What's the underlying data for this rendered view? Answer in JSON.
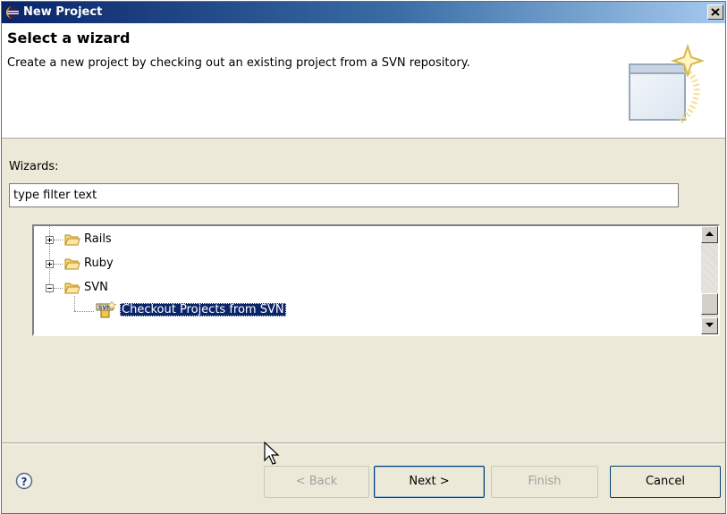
{
  "window": {
    "title": "New Project",
    "close_label": "Close"
  },
  "header": {
    "heading": "Select a wizard",
    "description": "Create a new project by checking out an existing project from a SVN repository."
  },
  "wizards_label": "Wizards:",
  "filter": {
    "value": "type filter text"
  },
  "tree": {
    "items": [
      {
        "label": "Rails",
        "expanded": false,
        "icon": "folder-icon"
      },
      {
        "label": "Ruby",
        "expanded": false,
        "icon": "folder-icon"
      },
      {
        "label": "SVN",
        "expanded": true,
        "icon": "folder-open-icon",
        "children": [
          {
            "label": "Checkout Projects from SVN",
            "icon": "svn-checkout-icon",
            "selected": true
          }
        ]
      }
    ]
  },
  "buttons": {
    "back": "< Back",
    "next": "Next >",
    "finish": "Finish",
    "cancel": "Cancel"
  },
  "colors": {
    "titlebar": "#0a246a",
    "selection": "#0a246a",
    "dialog_bg": "#ece9d8"
  }
}
